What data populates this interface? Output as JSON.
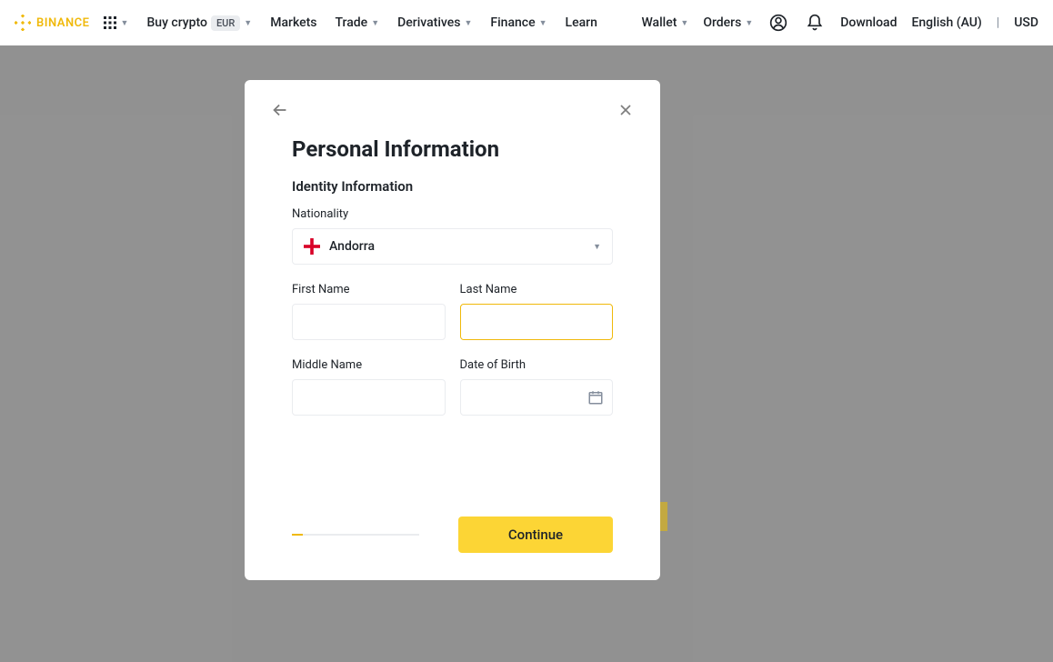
{
  "header": {
    "brand": "BINANCE",
    "buy_crypto_label": "Buy crypto",
    "buy_crypto_badge": "EUR",
    "nav": {
      "markets": "Markets",
      "trade": "Trade",
      "derivatives": "Derivatives",
      "finance": "Finance",
      "learn": "Learn"
    },
    "right": {
      "wallet": "Wallet",
      "orders": "Orders",
      "download": "Download",
      "language": "English (AU)",
      "currency": "USD"
    }
  },
  "modal": {
    "title": "Personal Information",
    "section": "Identity Information",
    "labels": {
      "nationality": "Nationality",
      "first_name": "First Name",
      "last_name": "Last Name",
      "middle_name": "Middle Name",
      "dob": "Date of Birth"
    },
    "nationality_value": "Andorra",
    "values": {
      "first_name": "",
      "last_name": "",
      "middle_name": "",
      "dob": ""
    },
    "continue_label": "Continue"
  }
}
